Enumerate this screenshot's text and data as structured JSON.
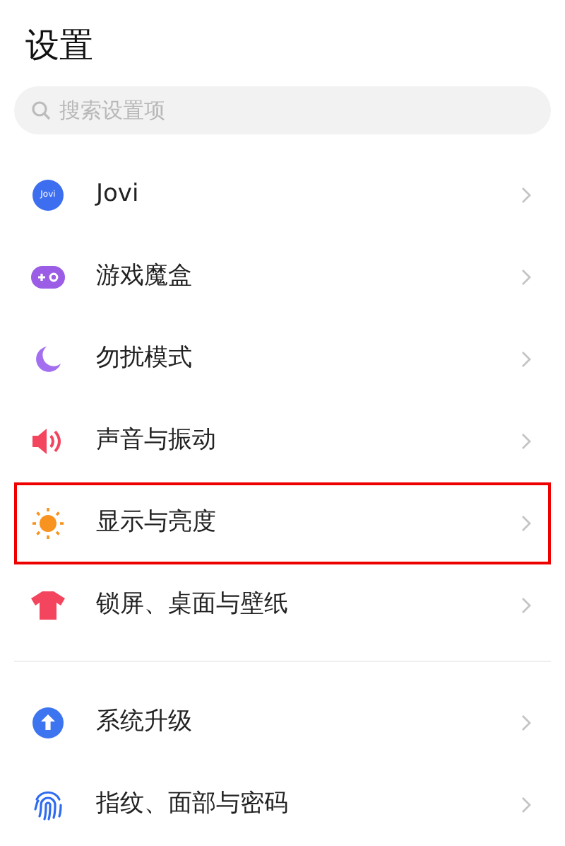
{
  "title": "设置",
  "search": {
    "placeholder": "搜索设置项"
  },
  "groups": [
    {
      "items": [
        {
          "kind": "jovi",
          "icon_text": "Jovi",
          "label": "Jovi",
          "highlighted": false
        },
        {
          "kind": "game",
          "label": "游戏魔盒",
          "highlighted": false
        },
        {
          "kind": "moon",
          "label": "勿扰模式",
          "highlighted": false
        },
        {
          "kind": "sound",
          "label": "声音与振动",
          "highlighted": false
        },
        {
          "kind": "sun",
          "label": "显示与亮度",
          "highlighted": true
        },
        {
          "kind": "shirt",
          "label": "锁屏、桌面与壁纸",
          "highlighted": false
        }
      ]
    },
    {
      "items": [
        {
          "kind": "upgrade",
          "label": "系统升级",
          "highlighted": false
        },
        {
          "kind": "fingerprint",
          "label": "指纹、面部与密码",
          "highlighted": false
        }
      ]
    }
  ]
}
